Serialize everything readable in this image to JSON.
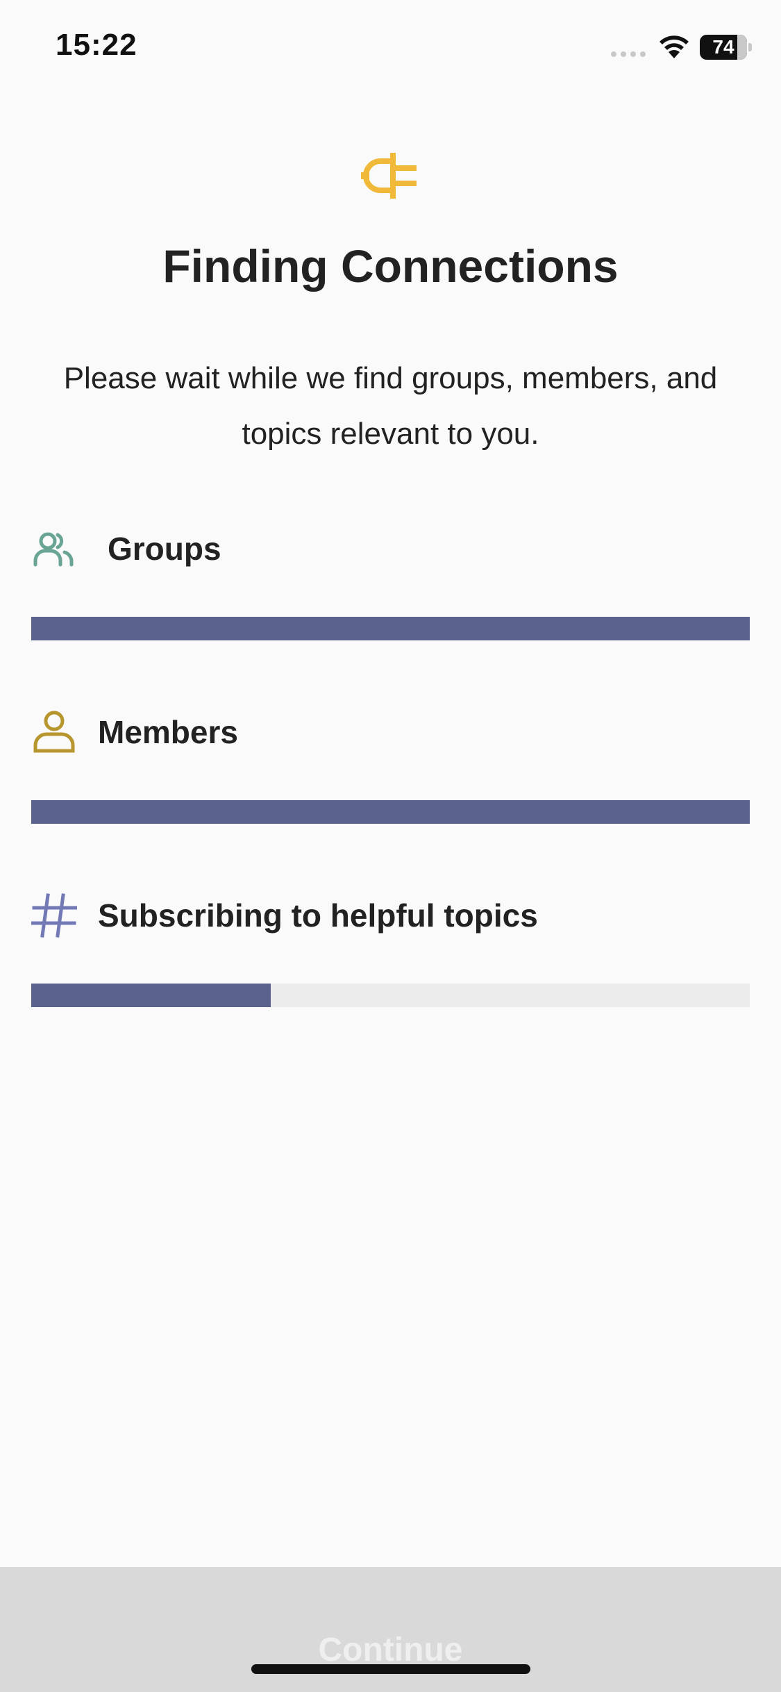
{
  "status_bar": {
    "time": "15:22",
    "battery": "74",
    "battery_level": 0.74,
    "icons": [
      "signal-dots-icon",
      "wifi-icon",
      "battery-icon"
    ]
  },
  "header": {
    "icon": "plug-icon",
    "icon_color": "#f0b93a",
    "title": "Finding Connections",
    "subtitle": "Please wait while we find groups, members, and topics relevant to you."
  },
  "sections": [
    {
      "label": "Groups",
      "icon": "groups-icon",
      "icon_color": "#6aa494",
      "progress": 1.0
    },
    {
      "label": "Members",
      "icon": "person-icon",
      "icon_color": "#b8962e",
      "progress": 1.0
    },
    {
      "label": "Subscribing to helpful topics",
      "icon": "hashtag-icon",
      "icon_color": "#7279b5",
      "progress": 0.333
    }
  ],
  "colors": {
    "progress_fill": "#5b618d",
    "progress_track": "#ececec",
    "footer_bg": "#d9d9d9"
  },
  "footer": {
    "continue_label": "Continue",
    "continue_enabled": false
  }
}
